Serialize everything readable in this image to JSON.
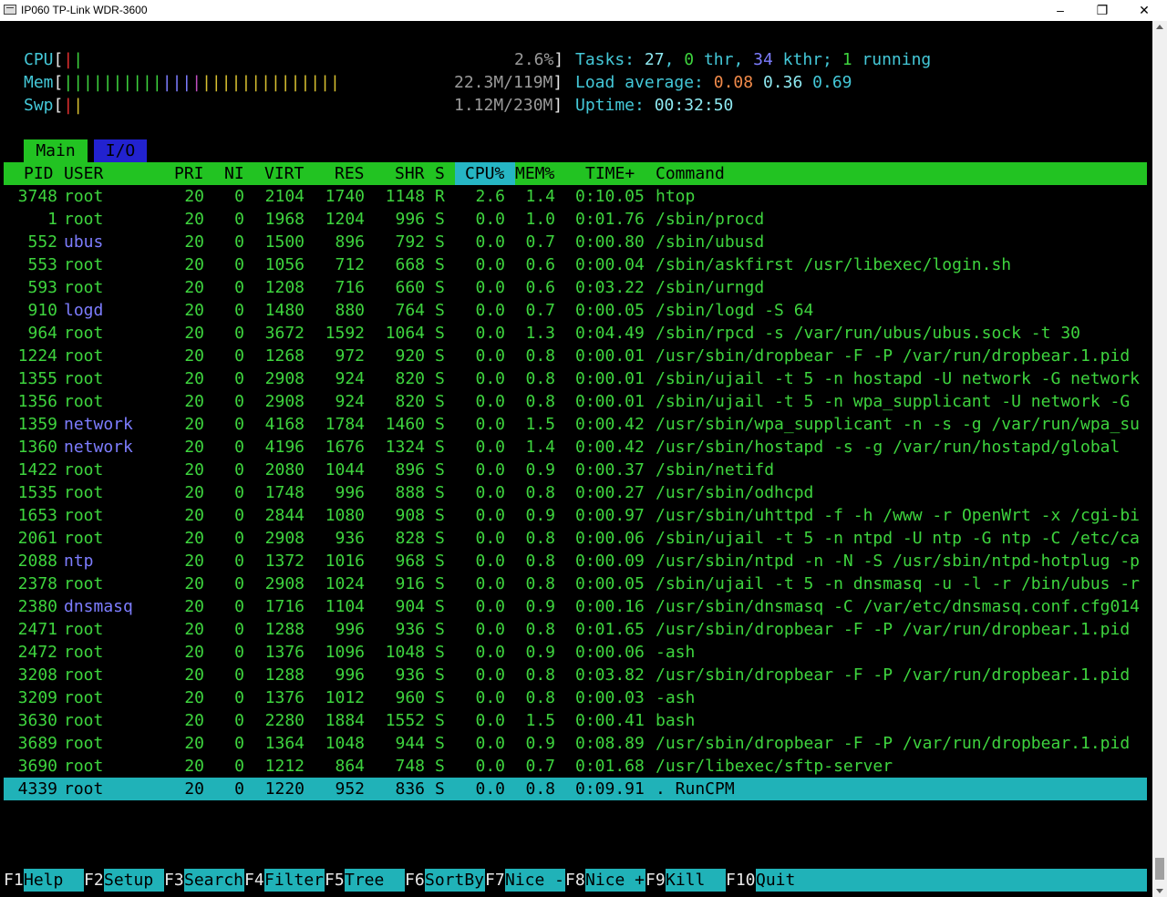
{
  "window": {
    "title": "IP060 TP-Link WDR-3600"
  },
  "meters": {
    "cpu": {
      "label": "CPU",
      "value": "2.6%"
    },
    "mem": {
      "label": "Mem",
      "value": "22.3M/119M"
    },
    "swp": {
      "label": "Swp",
      "value": "1.12M/230M"
    },
    "tasks": {
      "label": "Tasks:",
      "count": "27",
      "thr": "0",
      "thr_label": "thr,",
      "kthr": "34",
      "kthr_label": "kthr;",
      "running": "1",
      "running_label": "running"
    },
    "load": {
      "label": "Load average:",
      "one": "0.08",
      "five": "0.36",
      "fifteen": "0.69"
    },
    "uptime": {
      "label": "Uptime:",
      "value": "00:32:50"
    }
  },
  "tabs": [
    {
      "label": "Main"
    },
    {
      "label": "I/O"
    }
  ],
  "columns": {
    "pid": "PID",
    "user": "USER",
    "pri": "PRI",
    "ni": "NI",
    "virt": "VIRT",
    "res": "RES",
    "shr": "SHR",
    "s": "S",
    "cpu": "CPU%",
    "mem": "MEM%",
    "time": "TIME+",
    "cmd": "Command"
  },
  "processes": [
    {
      "pid": "3748",
      "user": "root",
      "pri": "20",
      "ni": "0",
      "virt": "2104",
      "res": "1740",
      "shr": "1148",
      "s": "R",
      "cpu": "2.6",
      "mem": "1.4",
      "time": "0:10.05",
      "cmd": "htop"
    },
    {
      "pid": "1",
      "user": "root",
      "pri": "20",
      "ni": "0",
      "virt": "1968",
      "res": "1204",
      "shr": "996",
      "s": "S",
      "cpu": "0.0",
      "mem": "1.0",
      "time": "0:01.76",
      "cmd": "/sbin/procd"
    },
    {
      "pid": "552",
      "user": "ubus",
      "pri": "20",
      "ni": "0",
      "virt": "1500",
      "res": "896",
      "shr": "792",
      "s": "S",
      "cpu": "0.0",
      "mem": "0.7",
      "time": "0:00.80",
      "cmd": "/sbin/ubusd"
    },
    {
      "pid": "553",
      "user": "root",
      "pri": "20",
      "ni": "0",
      "virt": "1056",
      "res": "712",
      "shr": "668",
      "s": "S",
      "cpu": "0.0",
      "mem": "0.6",
      "time": "0:00.04",
      "cmd": "/sbin/askfirst /usr/libexec/login.sh"
    },
    {
      "pid": "593",
      "user": "root",
      "pri": "20",
      "ni": "0",
      "virt": "1208",
      "res": "716",
      "shr": "660",
      "s": "S",
      "cpu": "0.0",
      "mem": "0.6",
      "time": "0:03.22",
      "cmd": "/sbin/urngd"
    },
    {
      "pid": "910",
      "user": "logd",
      "pri": "20",
      "ni": "0",
      "virt": "1480",
      "res": "880",
      "shr": "764",
      "s": "S",
      "cpu": "0.0",
      "mem": "0.7",
      "time": "0:00.05",
      "cmd": "/sbin/logd -S 64"
    },
    {
      "pid": "964",
      "user": "root",
      "pri": "20",
      "ni": "0",
      "virt": "3672",
      "res": "1592",
      "shr": "1064",
      "s": "S",
      "cpu": "0.0",
      "mem": "1.3",
      "time": "0:04.49",
      "cmd": "/sbin/rpcd -s /var/run/ubus/ubus.sock -t 30"
    },
    {
      "pid": "1224",
      "user": "root",
      "pri": "20",
      "ni": "0",
      "virt": "1268",
      "res": "972",
      "shr": "920",
      "s": "S",
      "cpu": "0.0",
      "mem": "0.8",
      "time": "0:00.01",
      "cmd": "/usr/sbin/dropbear -F -P /var/run/dropbear.1.pid"
    },
    {
      "pid": "1355",
      "user": "root",
      "pri": "20",
      "ni": "0",
      "virt": "2908",
      "res": "924",
      "shr": "820",
      "s": "S",
      "cpu": "0.0",
      "mem": "0.8",
      "time": "0:00.01",
      "cmd": "/sbin/ujail -t 5 -n hostapd -U network -G network"
    },
    {
      "pid": "1356",
      "user": "root",
      "pri": "20",
      "ni": "0",
      "virt": "2908",
      "res": "924",
      "shr": "820",
      "s": "S",
      "cpu": "0.0",
      "mem": "0.8",
      "time": "0:00.01",
      "cmd": "/sbin/ujail -t 5 -n wpa_supplicant -U network -G"
    },
    {
      "pid": "1359",
      "user": "network",
      "pri": "20",
      "ni": "0",
      "virt": "4168",
      "res": "1784",
      "shr": "1460",
      "s": "S",
      "cpu": "0.0",
      "mem": "1.5",
      "time": "0:00.42",
      "cmd": "/usr/sbin/wpa_supplicant -n -s -g /var/run/wpa_su"
    },
    {
      "pid": "1360",
      "user": "network",
      "pri": "20",
      "ni": "0",
      "virt": "4196",
      "res": "1676",
      "shr": "1324",
      "s": "S",
      "cpu": "0.0",
      "mem": "1.4",
      "time": "0:00.42",
      "cmd": "/usr/sbin/hostapd -s -g /var/run/hostapd/global"
    },
    {
      "pid": "1422",
      "user": "root",
      "pri": "20",
      "ni": "0",
      "virt": "2080",
      "res": "1044",
      "shr": "896",
      "s": "S",
      "cpu": "0.0",
      "mem": "0.9",
      "time": "0:00.37",
      "cmd": "/sbin/netifd"
    },
    {
      "pid": "1535",
      "user": "root",
      "pri": "20",
      "ni": "0",
      "virt": "1748",
      "res": "996",
      "shr": "888",
      "s": "S",
      "cpu": "0.0",
      "mem": "0.8",
      "time": "0:00.27",
      "cmd": "/usr/sbin/odhcpd"
    },
    {
      "pid": "1653",
      "user": "root",
      "pri": "20",
      "ni": "0",
      "virt": "2844",
      "res": "1080",
      "shr": "908",
      "s": "S",
      "cpu": "0.0",
      "mem": "0.9",
      "time": "0:00.97",
      "cmd": "/usr/sbin/uhttpd -f -h /www -r OpenWrt -x /cgi-bi"
    },
    {
      "pid": "2061",
      "user": "root",
      "pri": "20",
      "ni": "0",
      "virt": "2908",
      "res": "936",
      "shr": "828",
      "s": "S",
      "cpu": "0.0",
      "mem": "0.8",
      "time": "0:00.06",
      "cmd": "/sbin/ujail -t 5 -n ntpd -U ntp -G ntp -C /etc/ca"
    },
    {
      "pid": "2088",
      "user": "ntp",
      "pri": "20",
      "ni": "0",
      "virt": "1372",
      "res": "1016",
      "shr": "968",
      "s": "S",
      "cpu": "0.0",
      "mem": "0.8",
      "time": "0:00.09",
      "cmd": "/usr/sbin/ntpd -n -N -S /usr/sbin/ntpd-hotplug -p"
    },
    {
      "pid": "2378",
      "user": "root",
      "pri": "20",
      "ni": "0",
      "virt": "2908",
      "res": "1024",
      "shr": "916",
      "s": "S",
      "cpu": "0.0",
      "mem": "0.8",
      "time": "0:00.05",
      "cmd": "/sbin/ujail -t 5 -n dnsmasq -u -l -r /bin/ubus -r"
    },
    {
      "pid": "2380",
      "user": "dnsmasq",
      "pri": "20",
      "ni": "0",
      "virt": "1716",
      "res": "1104",
      "shr": "904",
      "s": "S",
      "cpu": "0.0",
      "mem": "0.9",
      "time": "0:00.16",
      "cmd": "/usr/sbin/dnsmasq -C /var/etc/dnsmasq.conf.cfg014"
    },
    {
      "pid": "2471",
      "user": "root",
      "pri": "20",
      "ni": "0",
      "virt": "1288",
      "res": "996",
      "shr": "936",
      "s": "S",
      "cpu": "0.0",
      "mem": "0.8",
      "time": "0:01.65",
      "cmd": "/usr/sbin/dropbear -F -P /var/run/dropbear.1.pid"
    },
    {
      "pid": "2472",
      "user": "root",
      "pri": "20",
      "ni": "0",
      "virt": "1376",
      "res": "1096",
      "shr": "1048",
      "s": "S",
      "cpu": "0.0",
      "mem": "0.9",
      "time": "0:00.06",
      "cmd": "-ash"
    },
    {
      "pid": "3208",
      "user": "root",
      "pri": "20",
      "ni": "0",
      "virt": "1288",
      "res": "996",
      "shr": "936",
      "s": "S",
      "cpu": "0.0",
      "mem": "0.8",
      "time": "0:03.82",
      "cmd": "/usr/sbin/dropbear -F -P /var/run/dropbear.1.pid"
    },
    {
      "pid": "3209",
      "user": "root",
      "pri": "20",
      "ni": "0",
      "virt": "1376",
      "res": "1012",
      "shr": "960",
      "s": "S",
      "cpu": "0.0",
      "mem": "0.8",
      "time": "0:00.03",
      "cmd": "-ash"
    },
    {
      "pid": "3630",
      "user": "root",
      "pri": "20",
      "ni": "0",
      "virt": "2280",
      "res": "1884",
      "shr": "1552",
      "s": "S",
      "cpu": "0.0",
      "mem": "1.5",
      "time": "0:00.41",
      "cmd": "bash"
    },
    {
      "pid": "3689",
      "user": "root",
      "pri": "20",
      "ni": "0",
      "virt": "1364",
      "res": "1048",
      "shr": "944",
      "s": "S",
      "cpu": "0.0",
      "mem": "0.9",
      "time": "0:08.89",
      "cmd": "/usr/sbin/dropbear -F -P /var/run/dropbear.1.pid"
    },
    {
      "pid": "3690",
      "user": "root",
      "pri": "20",
      "ni": "0",
      "virt": "1212",
      "res": "864",
      "shr": "748",
      "s": "S",
      "cpu": "0.0",
      "mem": "0.7",
      "time": "0:01.68",
      "cmd": "/usr/libexec/sftp-server"
    },
    {
      "pid": "4339",
      "user": "root",
      "pri": "20",
      "ni": "0",
      "virt": "1220",
      "res": "952",
      "shr": "836",
      "s": "S",
      "cpu": "0.0",
      "mem": "0.8",
      "time": "0:09.91",
      "cmd": ". RunCPM",
      "selected": true
    }
  ],
  "fkeys": [
    {
      "key": "F1",
      "label": "Help"
    },
    {
      "key": "F2",
      "label": "Setup"
    },
    {
      "key": "F3",
      "label": "Search"
    },
    {
      "key": "F4",
      "label": "Filter"
    },
    {
      "key": "F5",
      "label": "Tree"
    },
    {
      "key": "F6",
      "label": "SortBy"
    },
    {
      "key": "F7",
      "label": "Nice -"
    },
    {
      "key": "F8",
      "label": "Nice +"
    },
    {
      "key": "F9",
      "label": "Kill"
    },
    {
      "key": "F10",
      "label": "Quit"
    }
  ]
}
